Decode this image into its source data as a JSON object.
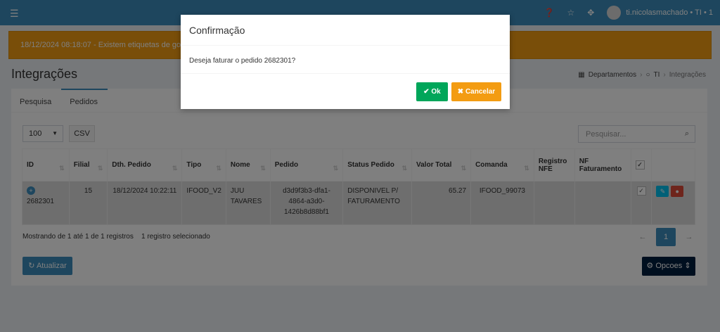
{
  "topbar": {
    "menu_icon": "hamburger-icon",
    "help_icon": "question-circle-icon",
    "star_icon": "star-icon",
    "expand_icon": "arrows-expand-icon",
    "user_label": "ti.nicolasmachado • TI • 1"
  },
  "alert": {
    "text": "18/12/2024 08:18:07 - Existem etiquetas de gondola"
  },
  "page": {
    "title": "Integrações"
  },
  "breadcrumb": {
    "item1": "Departamentos",
    "item2": "TI",
    "item3": "Integrações"
  },
  "tabs": [
    {
      "label": "Pesquisa"
    },
    {
      "label": "Pedidos"
    }
  ],
  "toolbar": {
    "page_size": "100",
    "csv_label": "CSV",
    "search_placeholder": "Pesquisar..."
  },
  "table": {
    "headers": [
      "ID",
      "Filial",
      "Dth. Pedido",
      "Tipo",
      "Nome",
      "Pedido",
      "Status Pedido",
      "Valor Total",
      "Comanda",
      "Registro NFE",
      "NF Faturamento"
    ],
    "rows": [
      {
        "id": "2682301",
        "filial": "15",
        "dth_pedido": "18/12/2024 10:22:11",
        "tipo": "IFOOD_V2",
        "nome": "JUU TAVARES",
        "pedido": "d3d9f3b3-dfa1-4864-a3d0-1426b8d88bf1",
        "status": "DISPONIVEL P/ FATURAMENTO",
        "valor_total": "65.27",
        "comanda": "IFOOD_99073",
        "registro_nfe": "",
        "nf_faturamento": ""
      }
    ]
  },
  "footer": {
    "info": "Mostrando de 1 até 1 de 1 registros",
    "selected": "1 registro selecionado",
    "prev": "←",
    "page": "1",
    "next": "→",
    "refresh_label": "Atualizar",
    "options_label": "Opcoes"
  },
  "modal": {
    "title": "Confirmação",
    "message": "Deseja faturar o pedido 2682301?",
    "ok_label": "Ok",
    "cancel_label": "Cancelar"
  },
  "colors": {
    "primary": "#3c8dbc",
    "warning": "#f39c12",
    "success": "#00a65a",
    "danger": "#dd4b39",
    "navy": "#001f3f"
  }
}
